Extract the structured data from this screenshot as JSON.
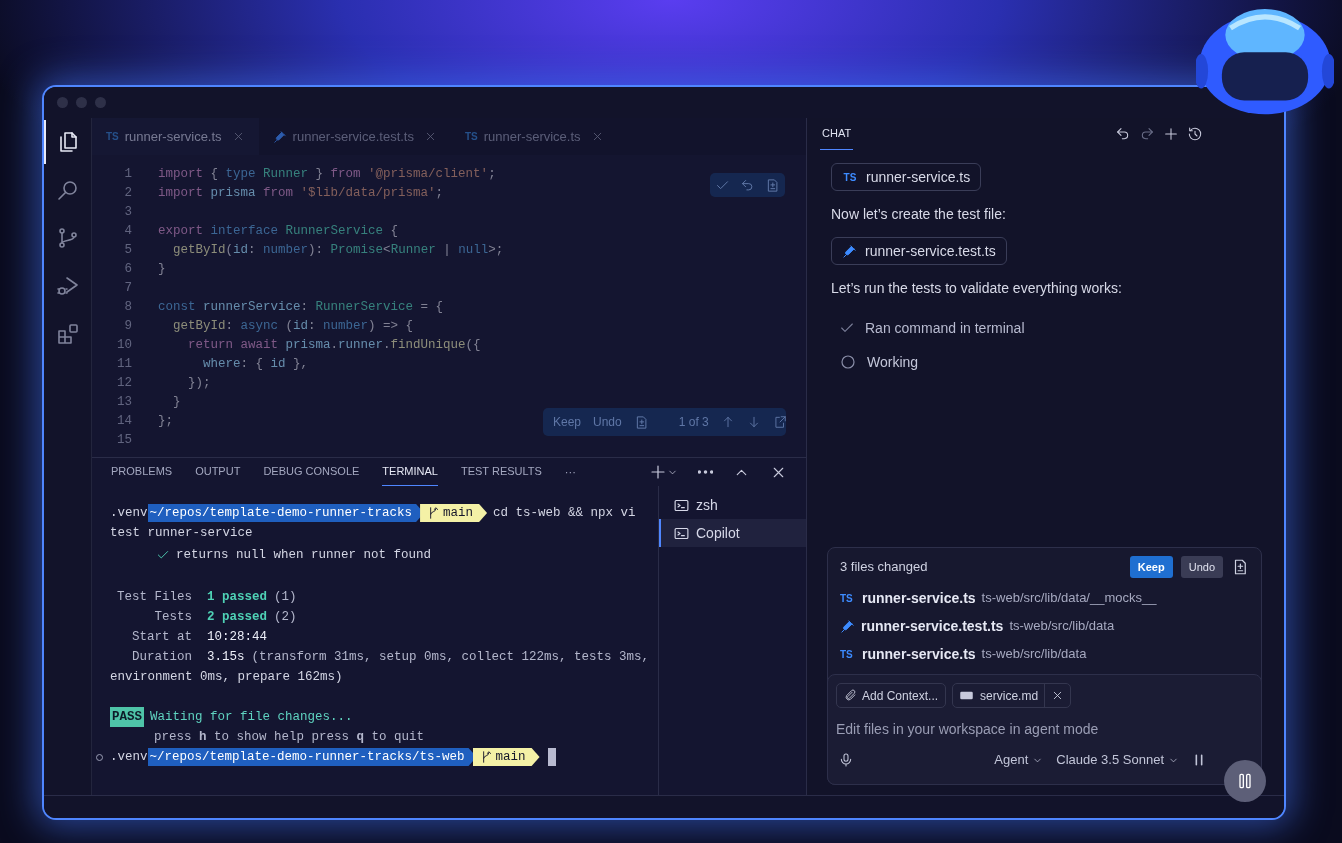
{
  "activity_bar": [
    {
      "kind": "explorer",
      "selected": true
    },
    {
      "kind": "search",
      "selected": false
    },
    {
      "kind": "source_control",
      "selected": false
    },
    {
      "kind": "run_debug",
      "selected": false
    },
    {
      "kind": "extensions",
      "selected": false
    }
  ],
  "editor": {
    "tabs": [
      {
        "badge": "TS",
        "label": "runner-service.ts",
        "selected": true
      },
      {
        "label": "runner-service.test.ts",
        "selected": false
      },
      {
        "badge": "TS",
        "label": "runner-service.ts",
        "selected": false
      }
    ],
    "lines": [
      {
        "number": "1",
        "tokens": [
          {
            "text": "import",
            "kind": "keyword"
          },
          {
            "text": " { ",
            "kind": "punct"
          },
          {
            "text": "type",
            "kind": "decl"
          },
          {
            "text": " Runner",
            "kind": "type"
          },
          {
            "text": " } ",
            "kind": "punct"
          },
          {
            "text": "from",
            "kind": "keyword"
          },
          {
            "text": " '@prisma/client'",
            "kind": "string"
          },
          {
            "text": ";",
            "kind": "punct"
          }
        ]
      },
      {
        "number": "2",
        "tokens": [
          {
            "text": "import",
            "kind": "keyword"
          },
          {
            "text": " prisma ",
            "kind": "var"
          },
          {
            "text": "from",
            "kind": "keyword"
          },
          {
            "text": " '$lib/data/prisma'",
            "kind": "string"
          },
          {
            "text": ";",
            "kind": "punct"
          }
        ]
      },
      {
        "number": "3"
      },
      {
        "number": "4",
        "tokens": [
          {
            "text": "export",
            "kind": "keyword"
          },
          {
            "text": " interface",
            "kind": "decl"
          },
          {
            "text": " RunnerService",
            "kind": "type"
          },
          {
            "text": " {",
            "kind": "punct"
          }
        ]
      },
      {
        "number": "5",
        "tokens": [
          {
            "text": "  getById",
            "kind": "func"
          },
          {
            "text": "(",
            "kind": "punct"
          },
          {
            "text": "id",
            "kind": "var"
          },
          {
            "text": ": ",
            "kind": "punct"
          },
          {
            "text": "number",
            "kind": "decl"
          },
          {
            "text": "): ",
            "kind": "punct"
          },
          {
            "text": "Promise",
            "kind": "type"
          },
          {
            "text": "<",
            "kind": "punct"
          },
          {
            "text": "Runner",
            "kind": "type"
          },
          {
            "text": " | ",
            "kind": "punct"
          },
          {
            "text": "null",
            "kind": "decl"
          },
          {
            "text": ">;",
            "kind": "punct"
          }
        ]
      },
      {
        "number": "6",
        "tokens": [
          {
            "text": "}",
            "kind": "punct"
          }
        ]
      },
      {
        "number": "7"
      },
      {
        "number": "8",
        "tokens": [
          {
            "text": "const",
            "kind": "decl"
          },
          {
            "text": " runnerService",
            "kind": "var"
          },
          {
            "text": ": ",
            "kind": "punct"
          },
          {
            "text": "RunnerService",
            "kind": "type"
          },
          {
            "text": " = {",
            "kind": "punct"
          }
        ]
      },
      {
        "number": "9",
        "tokens": [
          {
            "text": "  getById",
            "kind": "func"
          },
          {
            "text": ": ",
            "kind": "punct"
          },
          {
            "text": "async",
            "kind": "decl"
          },
          {
            "text": " (",
            "kind": "punct"
          },
          {
            "text": "id",
            "kind": "var"
          },
          {
            "text": ": ",
            "kind": "punct"
          },
          {
            "text": "number",
            "kind": "decl"
          },
          {
            "text": ") => {",
            "kind": "punct"
          }
        ]
      },
      {
        "number": "10",
        "tokens": [
          {
            "text": "    return",
            "kind": "keyword"
          },
          {
            "text": " await",
            "kind": "keyword"
          },
          {
            "text": " prisma",
            "kind": "var"
          },
          {
            "text": ".",
            "kind": "punct"
          },
          {
            "text": "runner",
            "kind": "var"
          },
          {
            "text": ".",
            "kind": "punct"
          },
          {
            "text": "findUnique",
            "kind": "func"
          },
          {
            "text": "({",
            "kind": "punct"
          }
        ]
      },
      {
        "number": "11",
        "tokens": [
          {
            "text": "      where",
            "kind": "var"
          },
          {
            "text": ": { ",
            "kind": "punct"
          },
          {
            "text": "id",
            "kind": "var"
          },
          {
            "text": " },",
            "kind": "punct"
          }
        ]
      },
      {
        "number": "12",
        "tokens": [
          {
            "text": "    });",
            "kind": "punct"
          }
        ]
      },
      {
        "number": "13",
        "tokens": [
          {
            "text": "  }",
            "kind": "punct"
          }
        ]
      },
      {
        "number": "14",
        "tokens": [
          {
            "text": "};",
            "kind": "punct"
          }
        ]
      },
      {
        "number": "15"
      }
    ],
    "change_bar": {
      "keep": "Keep",
      "undo": "Undo",
      "counter": "1 of 3"
    }
  },
  "panel": {
    "tabs": [
      {
        "label": "PROBLEMS",
        "selected": false
      },
      {
        "label": "OUTPUT",
        "selected": false
      },
      {
        "label": "DEBUG CONSOLE",
        "selected": false
      },
      {
        "label": "TERMINAL",
        "selected": true
      },
      {
        "label": "TEST RESULTS",
        "selected": false
      }
    ],
    "more": "···"
  },
  "terminal": {
    "lines": [
      {
        "kind": "prompt",
        "indicator": false,
        "env": ".venv",
        "path": "~/repos/template-demo-runner-tracks",
        "branch": "main",
        "command": "cd ts-web && npx vi",
        "cursor": false
      },
      {
        "kind": "text",
        "text": "test runner-service"
      },
      {
        "kind": "check",
        "text": "returns null when runner not found"
      },
      {
        "kind": "blank"
      },
      {
        "kind": "summary",
        "label": "Test Files",
        "value": "1 passed",
        "detail": "(1)",
        "highlight": true
      },
      {
        "kind": "summary",
        "label": "Tests",
        "value": "2 passed",
        "detail": "(2)",
        "highlight": true
      },
      {
        "kind": "summary",
        "label": "Start at",
        "value": "10:28:44",
        "highlight": false
      },
      {
        "kind": "summary",
        "label": "Duration",
        "value": "3.15s",
        "detail": "(transform 31ms, setup 0ms, collect 122ms, tests 3ms,",
        "highlight": false
      },
      {
        "kind": "text",
        "text": "environment 0ms, prepare 162ms)"
      },
      {
        "kind": "blank"
      },
      {
        "kind": "pass",
        "badge": "PASS",
        "text": "Waiting for file changes..."
      },
      {
        "kind": "hint",
        "text": "press **h** to show help press **q** to quit"
      },
      {
        "kind": "prompt",
        "indicator": true,
        "env": ".venv",
        "path": "~/repos/template-demo-runner-tracks/ts-web",
        "branch": "main",
        "cursor": true
      }
    ],
    "sessions": [
      {
        "label": "zsh",
        "selected": false
      },
      {
        "label": "Copilot",
        "selected": true
      }
    ]
  },
  "chat": {
    "tab": "CHAT",
    "messages": [
      {
        "kind": "file",
        "badge": "TS",
        "label": "runner-service.ts"
      },
      {
        "kind": "text",
        "text": "Now let’s create the test file:"
      },
      {
        "kind": "file",
        "label": "runner-service.test.ts"
      },
      {
        "kind": "text",
        "text": "Let’s run the tests to validate everything works:"
      },
      {
        "kind": "step",
        "done": true,
        "text": "Ran command in terminal"
      },
      {
        "kind": "step",
        "done": false,
        "text": "Working"
      }
    ],
    "changes": {
      "title": "3 files changed",
      "keep": "Keep",
      "undo": "Undo",
      "files": [
        {
          "badge": "TS",
          "name": "runner-service.ts",
          "path": "ts-web/src/lib/data/__mocks__"
        },
        {
          "name": "runner-service.test.ts",
          "path": "ts-web/src/lib/data"
        },
        {
          "badge": "TS",
          "name": "runner-service.ts",
          "path": "ts-web/src/lib/data"
        }
      ]
    },
    "input": {
      "chips": [
        {
          "kind": "add",
          "label": "Add Context..."
        },
        {
          "kind": "file",
          "label": "service.md"
        }
      ],
      "placeholder": "Edit files in your workspace in agent mode",
      "mode": "Agent",
      "model": "Claude 3.5 Sonnet"
    }
  }
}
